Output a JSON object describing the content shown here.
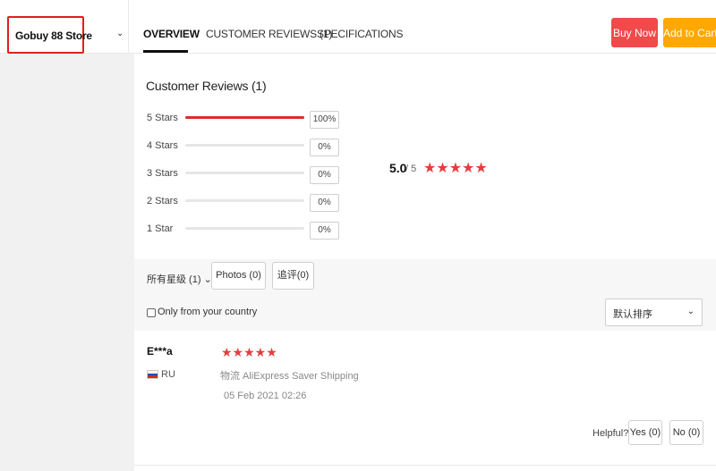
{
  "header": {
    "store_name": "Gobuy 88 Store",
    "tabs": [
      {
        "label": "OVERVIEW"
      },
      {
        "label": "CUSTOMER REVIEWS (1)"
      },
      {
        "label": "SPECIFICATIONS"
      }
    ],
    "buy_now_label": "Buy Now",
    "add_to_cart_label": "Add to Cart",
    "store_caret_icon": "chevron-down-icon"
  },
  "reviews_summary": {
    "title": "Customer Reviews (1)",
    "rows": [
      {
        "label": "5 Stars",
        "percent_label": "100%",
        "fraction": 1.0
      },
      {
        "label": "4 Stars",
        "percent_label": "0%",
        "fraction": 0
      },
      {
        "label": "3 Stars",
        "percent_label": "0%",
        "fraction": 0
      },
      {
        "label": "2 Stars",
        "percent_label": "0%",
        "fraction": 0
      },
      {
        "label": "1 Star",
        "percent_label": "0%",
        "fraction": 0
      }
    ],
    "average": "5.0",
    "average_of": "/ 5",
    "average_stars": "★★★★★",
    "colors": {
      "accent": "#e02b2b",
      "star": "#e43d3d"
    }
  },
  "filters": {
    "all_ratings": "所有星级 (1)",
    "photos_label": "Photos (0)",
    "followup_label": "追评(0)",
    "only_country_label": "Only from your country",
    "sort_value": "默认排序"
  },
  "review": {
    "reviewer": "E***a",
    "country": "RU",
    "stars": "★★★★★",
    "shipping": "物流 AliExpress Saver Shipping",
    "date": "05 Feb 2021 02:26",
    "helpful_label": "Helpful?",
    "yes_label": "Yes (0)",
    "no_label": "No (0)"
  }
}
